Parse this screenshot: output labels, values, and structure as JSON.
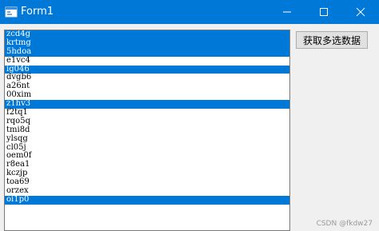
{
  "window": {
    "title": "Form1"
  },
  "listbox": {
    "items": [
      {
        "text": "zcd4g",
        "selected": true
      },
      {
        "text": "krtmg",
        "selected": true
      },
      {
        "text": "5hdoa",
        "selected": true
      },
      {
        "text": "e1vc4",
        "selected": false
      },
      {
        "text": "ig046",
        "selected": true
      },
      {
        "text": "dvgb6",
        "selected": false
      },
      {
        "text": "a26nt",
        "selected": false
      },
      {
        "text": "00xim",
        "selected": false
      },
      {
        "text": "z1hv3",
        "selected": true
      },
      {
        "text": "f2tq1",
        "selected": false
      },
      {
        "text": "rqo5q",
        "selected": false
      },
      {
        "text": "tmi8d",
        "selected": false
      },
      {
        "text": "ylsqg",
        "selected": false
      },
      {
        "text": "cl05j",
        "selected": false
      },
      {
        "text": "oem0f",
        "selected": false
      },
      {
        "text": "r8ea1",
        "selected": false
      },
      {
        "text": "kczjp",
        "selected": false
      },
      {
        "text": "toa69",
        "selected": false
      },
      {
        "text": "orzex",
        "selected": false
      },
      {
        "text": "oi1p0",
        "selected": true
      }
    ]
  },
  "buttons": {
    "get_selected_label": "获取多选数据"
  },
  "watermark": "CSDN @fkdw27",
  "colors": {
    "accent": "#0078d7",
    "selection_text": "#ffffff",
    "background": "#f0f0f0"
  }
}
